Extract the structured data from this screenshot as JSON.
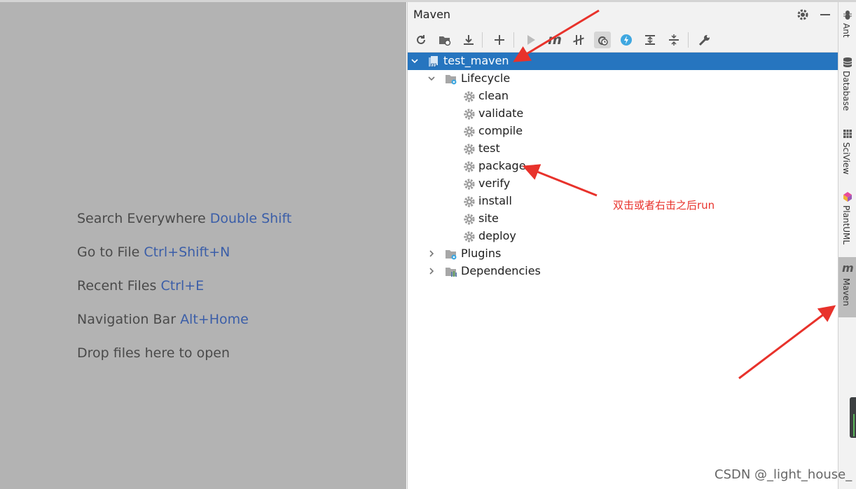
{
  "editor": {
    "hints": [
      {
        "text": "Search Everywhere",
        "key": "Double Shift"
      },
      {
        "text": "Go to File",
        "key": "Ctrl+Shift+N"
      },
      {
        "text": "Recent Files",
        "key": "Ctrl+E"
      },
      {
        "text": "Navigation Bar",
        "key": "Alt+Home"
      },
      {
        "text": "Drop files here to open",
        "key": ""
      }
    ]
  },
  "maven": {
    "title": "Maven",
    "toolbar": [
      {
        "name": "reload-icon",
        "glyph": "⟳"
      },
      {
        "name": "generate-sources-icon",
        "glyph": "▣"
      },
      {
        "name": "download-icon",
        "glyph": "⤓"
      },
      {
        "name": "add-icon",
        "glyph": "+"
      },
      {
        "name": "run-icon",
        "glyph": "▶"
      },
      {
        "name": "execute-goal-icon",
        "glyph": "m"
      },
      {
        "name": "toggle-offline-icon",
        "glyph": "⫲"
      },
      {
        "name": "skip-tests-icon",
        "glyph": "⟲"
      },
      {
        "name": "show-dependencies-icon",
        "glyph": "⚡"
      },
      {
        "name": "expand-all-icon",
        "glyph": "⇅"
      },
      {
        "name": "collapse-all-icon",
        "glyph": "⇵"
      },
      {
        "name": "settings-wrench-icon",
        "glyph": "🔧"
      }
    ],
    "tree": {
      "project": "test_maven",
      "lifecycle": "Lifecycle",
      "goals": [
        "clean",
        "validate",
        "compile",
        "test",
        "package",
        "verify",
        "install",
        "site",
        "deploy"
      ],
      "plugins": "Plugins",
      "dependencies": "Dependencies"
    }
  },
  "stripe": {
    "items": [
      "Ant",
      "Database",
      "SciView",
      "PlantUML",
      "Maven"
    ],
    "active": "Maven"
  },
  "annotation": {
    "note": "双击或者右击之后run",
    "color": "#e8322b"
  },
  "watermark": "CSDN @_light_house_"
}
